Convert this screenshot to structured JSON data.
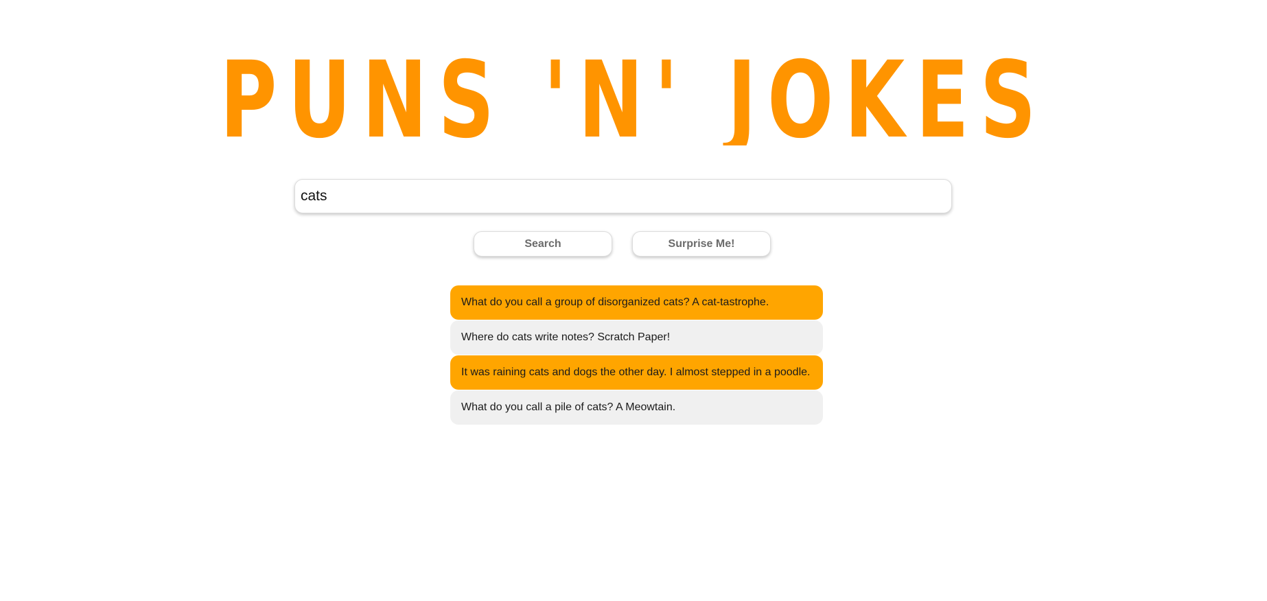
{
  "header": {
    "title": "PUNS 'N' JOKES"
  },
  "colors": {
    "brand_orange": "#ff9400",
    "highlight_orange": "#ffa500",
    "row_gray": "#f0f0f0"
  },
  "search": {
    "value": "cats",
    "placeholder": ""
  },
  "buttons": {
    "search_label": "Search",
    "surprise_label": "Surprise Me!"
  },
  "results": [
    {
      "text": "What do you call a group of disorganized cats? A cat-tastrophe."
    },
    {
      "text": "Where do cats write notes? Scratch Paper!"
    },
    {
      "text": "It was raining cats and dogs the other day. I almost stepped in a poodle."
    },
    {
      "text": "What do you call a pile of cats? A Meowtain."
    }
  ]
}
